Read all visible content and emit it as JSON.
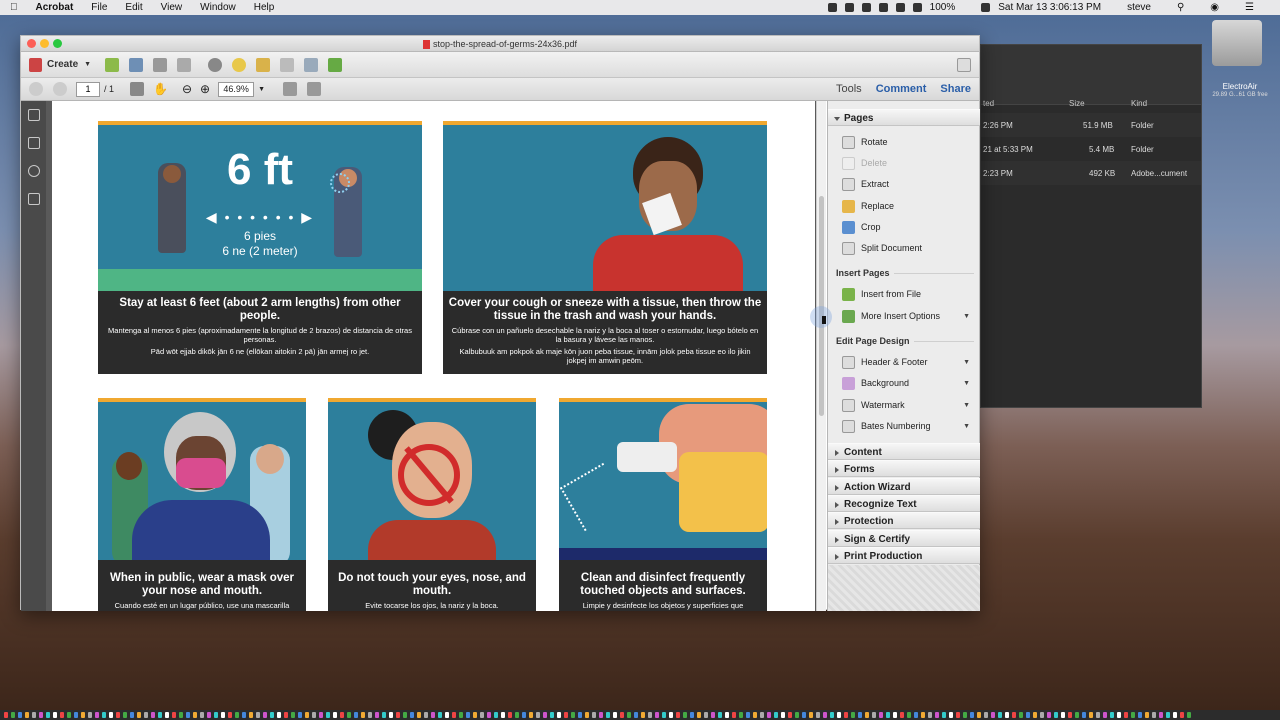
{
  "menubar": {
    "app": "Acrobat",
    "items": [
      "File",
      "Edit",
      "View",
      "Window",
      "Help"
    ],
    "battery": "100%",
    "datetime": "Sat Mar 13  3:06:13 PM",
    "user": "steve"
  },
  "desktop": {
    "drive_name": "ElectroAir",
    "drive_info": "29.89 G...61 GB free"
  },
  "finder": {
    "col_modified": "ted",
    "col_size": "Size",
    "col_kind": "Kind",
    "rows": [
      {
        "date": "2:26 PM",
        "size": "51.9 MB",
        "kind": "Folder"
      },
      {
        "date": "21 at 5:33 PM",
        "size": "5.4 MB",
        "kind": "Folder"
      },
      {
        "date": "2:23 PM",
        "size": "492 KB",
        "kind": "Adobe...cument"
      }
    ]
  },
  "window": {
    "title": "stop-the-spread-of-germs-24x36.pdf"
  },
  "toolbar": {
    "create_label": "Create",
    "page_current": "1",
    "page_total": "/ 1",
    "zoom": "46.9%",
    "tools_label": "Tools",
    "comment_label": "Comment",
    "share_label": "Share"
  },
  "document": {
    "panels": [
      {
        "big": "6 ft",
        "sub1": "6 pies",
        "sub2": "6 ne (2 meter)",
        "title": "Stay at least 6 feet (about 2 arm lengths) from other people.",
        "es": "Mantenga al menos 6 pies (aproximadamente la longitud de 2 brazos) de distancia de otras personas.",
        "mh": "Pād wōt ejjab dikōk jān 6 ne (ellōkan aitokin 2 pā) jān armej ro jet."
      },
      {
        "title": "Cover your cough or sneeze with a tissue, then throw the tissue in the trash and wash your hands.",
        "es": "Cúbrase con un pañuelo desechable la nariz y la boca al toser o estornudar, luego bótelo en la basura y lávese las manos.",
        "mh": "Kalbubuuk am pokpok ak maje kōn juon peba tissue, innām jolok peba tissue eo ilo jikin jokpej im amwin peōm."
      },
      {
        "title": "When in public, wear a mask over your nose and mouth.",
        "es": "Cuando esté en un lugar público, use una mascarilla"
      },
      {
        "title": "Do not touch your eyes, nose, and mouth.",
        "es": "Evite tocarse los ojos, la nariz y la boca."
      },
      {
        "title": "Clean and disinfect  frequently touched objects and surfaces.",
        "es": "Limpie y desinfecte los objetos y superficies que"
      }
    ]
  },
  "tools_pane": {
    "pages": {
      "title": "Pages",
      "items": [
        "Rotate",
        "Delete",
        "Extract",
        "Replace",
        "Crop",
        "Split Document"
      ]
    },
    "insert_pages": {
      "title": "Insert Pages",
      "items": [
        "Insert from File",
        "More Insert Options"
      ]
    },
    "edit_design": {
      "title": "Edit Page Design",
      "items": [
        "Header & Footer",
        "Background",
        "Watermark",
        "Bates Numbering"
      ]
    },
    "sections": [
      "Content",
      "Forms",
      "Action Wizard",
      "Recognize Text",
      "Protection",
      "Sign & Certify",
      "Print Production"
    ]
  },
  "colors": {
    "panel_blue": "#2d7f9c",
    "panel_dark": "#2b2b2b",
    "accent_orange": "#f0a830",
    "tab_blue": "#2a5ea8"
  }
}
